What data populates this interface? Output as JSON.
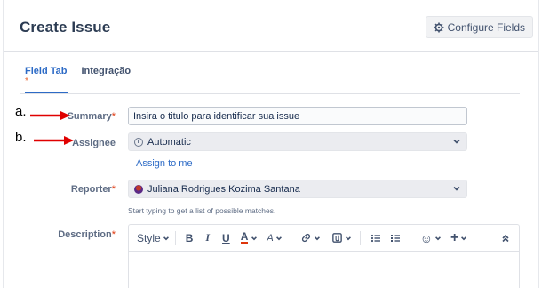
{
  "header": {
    "title": "Create Issue",
    "configure_label": "Configure Fields"
  },
  "tabs": [
    {
      "label": "Field Tab",
      "active": true,
      "required_mark": "*"
    },
    {
      "label": "Integração",
      "active": false
    }
  ],
  "annotations": {
    "a": "a.",
    "b": "b."
  },
  "form": {
    "summary": {
      "label": "Summary",
      "required": "*",
      "value": "Insira o titulo para identificar sua issue"
    },
    "assignee": {
      "label": "Assignee",
      "value": "Automatic",
      "assign_link": "Assign to me"
    },
    "reporter": {
      "label": "Reporter",
      "required": "*",
      "value": "Juliana Rodrigues Kozima Santana",
      "helper": "Start typing to get a list of possible matches."
    },
    "description": {
      "label": "Description",
      "required": "*"
    }
  },
  "editor_toolbar": {
    "style_label": "Style",
    "bold": "B",
    "italic": "I",
    "underline": "U",
    "text_color": "A",
    "more_format": "A",
    "emoji": "☺",
    "insert": "+",
    "collapse": "⌃"
  },
  "colors": {
    "accent": "#2d6bc6",
    "required": "#de350b",
    "arrow": "#e00000"
  }
}
